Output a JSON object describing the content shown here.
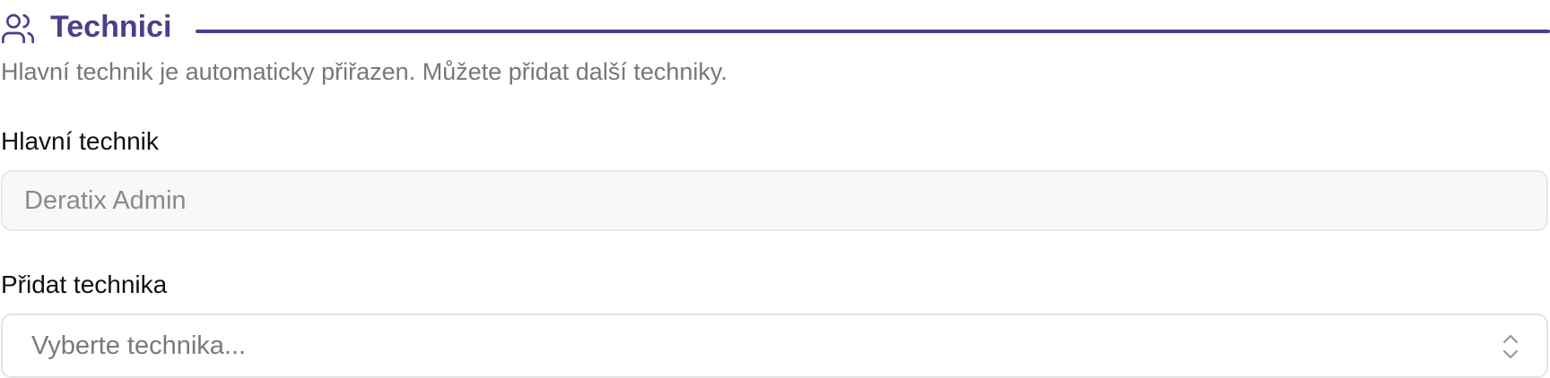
{
  "section": {
    "title": "Technici",
    "icon": "users-icon",
    "accent_color": "#4b3f8c",
    "hint": "Hlavní technik je automaticky přiřazen. Můžete přidat další techniky."
  },
  "main_technician": {
    "label": "Hlavní technik",
    "value": "Deratix Admin"
  },
  "add_technician": {
    "label": "Přidat technika",
    "placeholder": "Vyberte technika...",
    "icon": "chevron-up-down-icon"
  }
}
